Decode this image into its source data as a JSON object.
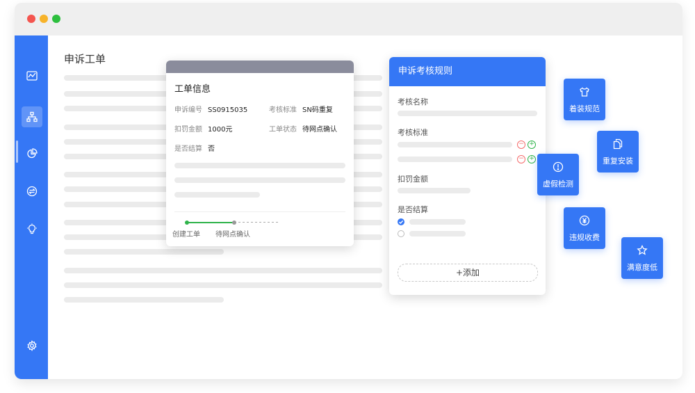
{
  "window": {
    "controls": [
      "close",
      "minimize",
      "maximize"
    ]
  },
  "sidebar": {
    "items": [
      {
        "icon": "activity-icon"
      },
      {
        "icon": "org-chart-icon",
        "active": true
      },
      {
        "icon": "pie-chart-icon"
      },
      {
        "icon": "transfer-icon"
      },
      {
        "icon": "lightbulb-icon"
      },
      {
        "icon": "gear-icon"
      }
    ]
  },
  "page": {
    "title": "申诉工单"
  },
  "ticket_info": {
    "title": "工单信息",
    "fields": [
      {
        "label": "申诉编号",
        "value": "SS0915035"
      },
      {
        "label": "考核标准",
        "value": "SN码重复"
      },
      {
        "label": "扣罚金额",
        "value": "1000元"
      },
      {
        "label": "工单状态",
        "value": "待网点确认"
      },
      {
        "label": "是否结算",
        "value": "否"
      }
    ],
    "timeline": [
      {
        "label": "创建工单",
        "status": "done"
      },
      {
        "label": "待网点确认",
        "status": "current"
      }
    ]
  },
  "rules": {
    "title": "申诉考核规则",
    "labels": {
      "name": "考核名称",
      "standard": "考核标准",
      "amount": "扣罚金额",
      "settle": "是否结算"
    },
    "add_button": "+添加"
  },
  "categories": [
    {
      "label": "着装规范",
      "icon": "shirt-icon"
    },
    {
      "label": "重复安装",
      "icon": "copy-icon"
    },
    {
      "label": "虚假检测",
      "icon": "alert-icon"
    },
    {
      "label": "违规收费",
      "icon": "yuan-icon"
    },
    {
      "label": "满意度低",
      "icon": "star-icon"
    }
  ],
  "colors": {
    "primary": "#3577f5",
    "success": "#2fb34a",
    "danger": "#f56c6c",
    "header_bar": "#8a8c9c"
  }
}
